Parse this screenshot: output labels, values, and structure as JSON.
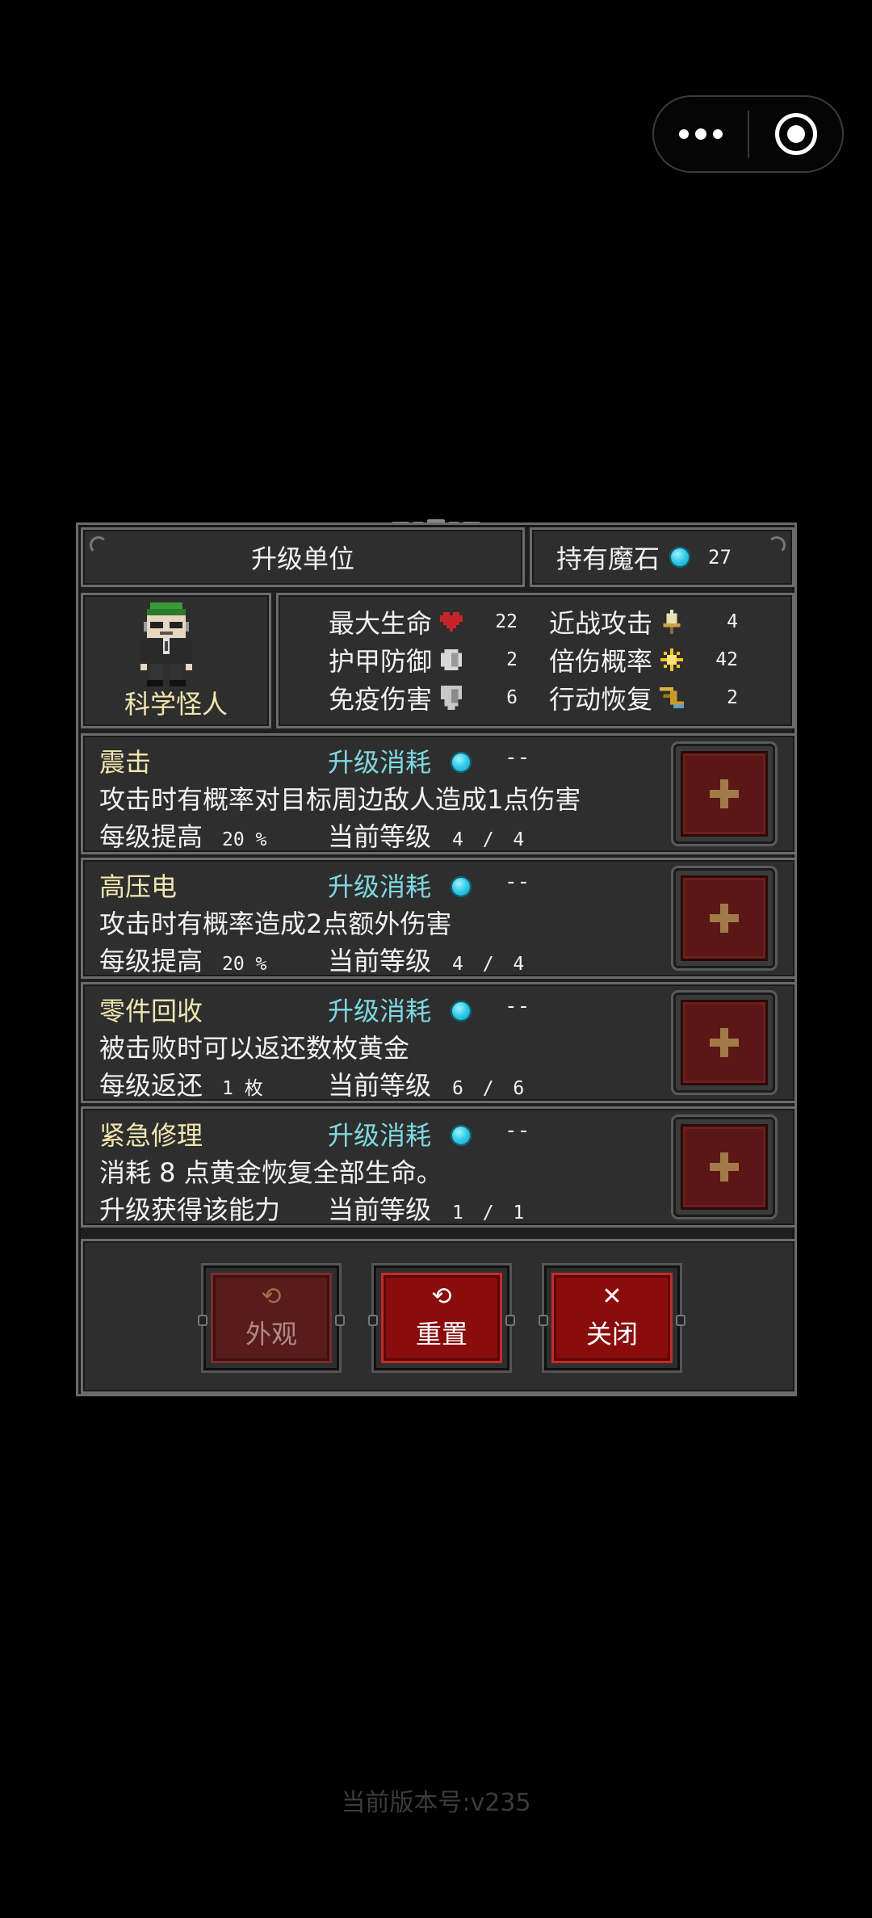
{
  "capsule": {
    "more_icon": "more-dots-icon",
    "close_icon": "target-circle-icon"
  },
  "header": {
    "title": "升级单位",
    "gem_label": "持有魔石",
    "gem_count": "27"
  },
  "unit": {
    "name": "科学怪人"
  },
  "stats": [
    {
      "label": "最大生命",
      "icon": "heart-icon",
      "value": "22"
    },
    {
      "label": "近战攻击",
      "icon": "sword-icon",
      "value": "4"
    },
    {
      "label": "护甲防御",
      "icon": "armor-icon",
      "value": "2"
    },
    {
      "label": "倍伤概率",
      "icon": "burst-icon",
      "value": "42"
    },
    {
      "label": "免疫伤害",
      "icon": "shield-icon",
      "value": "6"
    },
    {
      "label": "行动恢复",
      "icon": "boot-icon",
      "value": "2"
    }
  ],
  "skills": [
    {
      "name": "震击",
      "cost_label": "升级消耗",
      "cost": "--",
      "desc": "攻击时有概率对目标周边敌人造成1点伤害",
      "per_label": "每级提高",
      "per_value": "20 %",
      "level_label": "当前等级",
      "level": "4 / 4"
    },
    {
      "name": "高压电",
      "cost_label": "升级消耗",
      "cost": "--",
      "desc": "攻击时有概率造成2点额外伤害",
      "per_label": "每级提高",
      "per_value": "20 %",
      "level_label": "当前等级",
      "level": "4 / 4"
    },
    {
      "name": "零件回收",
      "cost_label": "升级消耗",
      "cost": "--",
      "desc": "被击败时可以返还数枚黄金",
      "per_label": "每级返还",
      "per_value": "1 枚",
      "level_label": "当前等级",
      "level": "6 / 6"
    },
    {
      "name": "紧急修理",
      "cost_label": "升级消耗",
      "cost": "--",
      "desc": "消耗 8 点黄金恢复全部生命。",
      "per_label": "升级获得该能力",
      "per_value": "",
      "level_label": "当前等级",
      "level": "1 / 1"
    }
  ],
  "actions": {
    "appearance": "外观",
    "reset": "重置",
    "close": "关闭"
  },
  "footer": {
    "version": "当前版本号:v235"
  },
  "colors": {
    "accent_red": "#8a0c0c",
    "gem": "#2fc8e6",
    "title_yellow": "#f0e6b0",
    "cost_cyan": "#7fd8e0"
  }
}
